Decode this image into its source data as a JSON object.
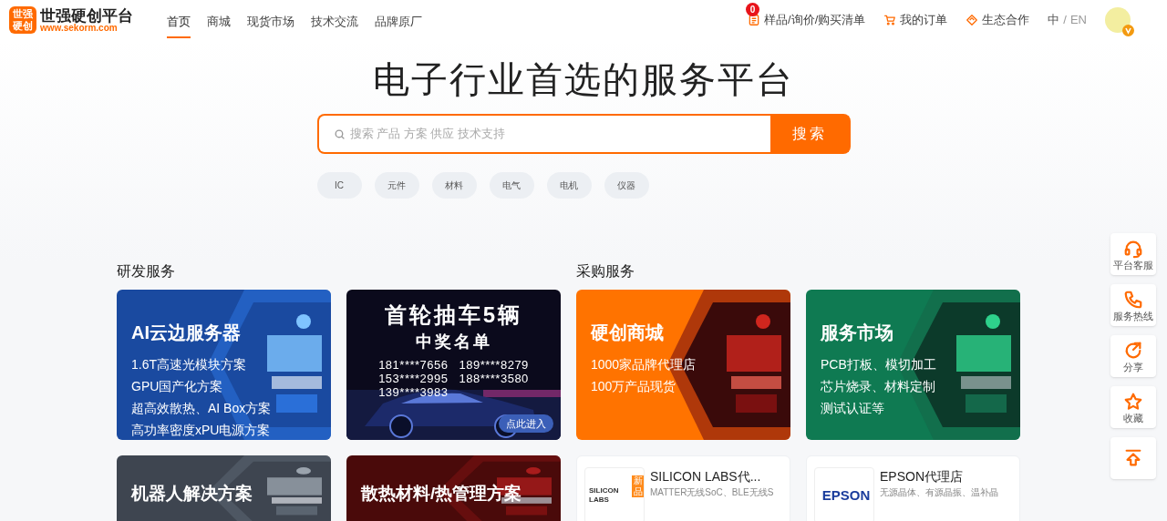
{
  "header": {
    "logo": {
      "mark_top": "世强",
      "mark_bottom": "硬创",
      "name": "世强硬创平台",
      "url": "www.sekorm.com"
    },
    "nav": [
      {
        "label": "首页",
        "selected": true
      },
      {
        "label": "商城",
        "selected": false
      },
      {
        "label": "现货市场",
        "selected": false
      },
      {
        "label": "技术交流",
        "selected": false
      },
      {
        "label": "品牌原厂",
        "selected": false
      }
    ],
    "links": [
      {
        "kind": "list",
        "label": "样品/询价/购买清单",
        "badge": "0"
      },
      {
        "kind": "cart",
        "label": "我的订单"
      },
      {
        "kind": "diamond",
        "label": "生态合作"
      }
    ],
    "language": {
      "current": "中",
      "separator": "/",
      "other": "EN"
    }
  },
  "hero": {
    "title": "电子行业首选的服务平台",
    "search": {
      "placeholder": "搜索 产品 方案 供应 技术支持",
      "button": "搜索"
    },
    "tags": [
      "IC",
      "元件",
      "材料",
      "电气",
      "电机",
      "仪器"
    ]
  },
  "sections": [
    {
      "title": "研发服务",
      "cards": [
        {
          "kind": "blue",
          "title": "AI云边服务器",
          "lines": [
            "1.6T高速光模块方案",
            "GPU国产化方案",
            "超高效散热、AI Box方案",
            "高功率密度xPU电源方案"
          ]
        },
        {
          "kind": "car",
          "title": "首轮抽车5辆",
          "subtitle": "中奖名单",
          "lines": [
            "181****7656",
            "189****8279",
            "153****2995",
            "188****3580",
            "139****3983"
          ],
          "button": "点此进入"
        }
      ]
    },
    {
      "title": "采购服务",
      "cards": [
        {
          "kind": "orange",
          "title": "硬创商城",
          "lines": [
            "1000家品牌代理店",
            "100万产品现货"
          ]
        },
        {
          "kind": "green",
          "title": "服务市场",
          "lines": [
            "PCB打板、模切加工",
            "芯片烧录、材料定制",
            "测试认证等"
          ]
        }
      ]
    }
  ],
  "more_cards": [
    {
      "kind": "gray",
      "title": "机器人解决方案"
    },
    {
      "kind": "red",
      "title": "散热材料/热管理方案"
    },
    {
      "kind": "store",
      "logo": "SILICON LABS",
      "tag": "新品",
      "title": "SILICON LABS代...",
      "text": "MATTER无线SoC、BLE无线S"
    },
    {
      "kind": "store",
      "logo": "EPSON",
      "title": "EPSON代理店",
      "text": "无源晶体、有源晶振、温补晶"
    }
  ],
  "side_tools": [
    {
      "kind": "headset",
      "label": "平台客服"
    },
    {
      "kind": "phone",
      "label": "服务热线"
    },
    {
      "kind": "share",
      "label": "分享"
    },
    {
      "kind": "star",
      "label": "收藏"
    },
    {
      "kind": "top"
    }
  ]
}
